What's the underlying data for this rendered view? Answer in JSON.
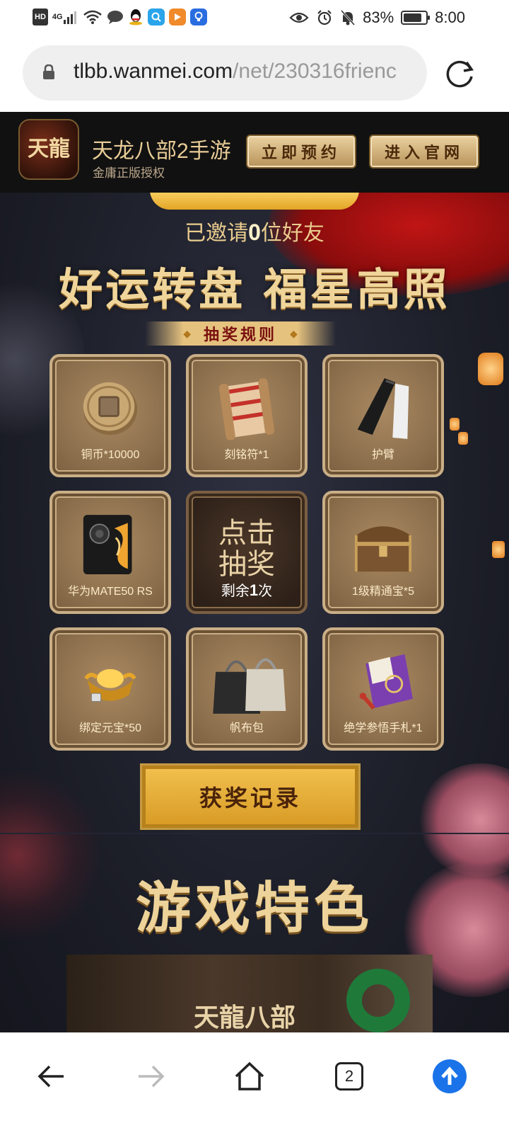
{
  "status_bar": {
    "left_icons": [
      "hd-icon",
      "signal-4g-icon",
      "wifi-icon",
      "chat-icon",
      "qq-icon",
      "search-app-icon",
      "video-app-icon",
      "bulb-app-icon"
    ],
    "hd_label": "HD",
    "network_label": "4G",
    "battery": "83%",
    "battery_level": 0.83,
    "time": "8:00"
  },
  "browser": {
    "url_domain": "tlbb.wanmei.com",
    "url_path": "/net/230316frienc",
    "tab_count": "2"
  },
  "app_banner": {
    "logo_text": "天龍",
    "name": "天龙八部2手游",
    "subtitle": "金庸正版授权",
    "reserve_button": "立即预约",
    "official_button": "进入官网"
  },
  "invite": {
    "prefix": "已邀请",
    "count": "0",
    "suffix": "位好友"
  },
  "lottery": {
    "title": "好运转盘 福星高照",
    "rules_label": "抽奖规则",
    "prizes": [
      {
        "label": "铜币*10000",
        "icon": "copper-coin-icon"
      },
      {
        "label": "刻铭符*1",
        "icon": "scroll-talisman-icon"
      },
      {
        "label": "护臂",
        "icon": "arm-sleeves-icon"
      },
      {
        "label": "华为MATE50 RS",
        "icon": "phone-icon"
      },
      {
        "label": "1级精通宝*5",
        "icon": "treasure-chest-icon"
      },
      {
        "label": "绑定元宝*50",
        "icon": "gold-ingot-icon"
      },
      {
        "label": "帆布包",
        "icon": "tote-bag-icon"
      },
      {
        "label": "绝学参悟手札*1",
        "icon": "manual-book-icon"
      }
    ],
    "draw_line1": "点击",
    "draw_line2": "抽奖",
    "remaining_prefix": "剩余",
    "remaining_count": "1",
    "remaining_suffix": "次",
    "record_button": "获奖记录"
  },
  "features": {
    "title": "游戏特色",
    "banner_logo": "天龍八部"
  },
  "colors": {
    "gold": "#f0d59a",
    "banner_bg": "#111111",
    "page_bg": "#1c1e28",
    "accent_blue": "#1a73e8"
  }
}
